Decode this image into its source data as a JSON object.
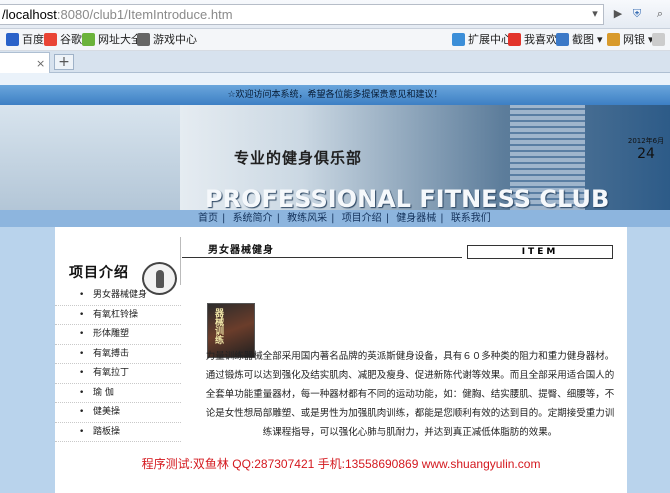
{
  "browser": {
    "url_main": "/localhost",
    "url_rest": ":8080/club1/ItemIntroduce.htm",
    "bookmarks": [
      {
        "label": "百度",
        "color": "#2a62c9"
      },
      {
        "label": "谷歌",
        "color": "#e94435"
      },
      {
        "label": "网址大全",
        "color": "#6bb33b"
      },
      {
        "label": "游戏中心",
        "color": "#666666"
      },
      {
        "label": "扩展中心",
        "color": "#3b8ed8"
      },
      {
        "label": "我喜欢",
        "color": "#e2342b"
      },
      {
        "label": "截图",
        "color": "#3c79c7"
      },
      {
        "label": "网银",
        "color": "#d89a2c"
      }
    ],
    "tab_close": "×",
    "new_tab": "+"
  },
  "site": {
    "welcome": "☆欢迎访问本系统，希望各位能多提保贵意见和建议！",
    "slogan": "专业的健身俱乐部",
    "title": "PROFESSIONAL FITNESS CLUB",
    "date_month": "2012年6月",
    "date_day": "24",
    "nav": [
      "首页",
      "系统简介",
      "教练风采",
      "项目介绍",
      "健身器械",
      "联系我们"
    ]
  },
  "sidebar": {
    "title": "项目介绍",
    "items": [
      "男女器械健身",
      "有氧杠铃操",
      "形体雕塑",
      "有氧搏击",
      "有氧拉丁",
      "瑜 伽",
      "健美操",
      "踏板操"
    ]
  },
  "main": {
    "section_title": "男女器械健身",
    "item_label": "ITEM",
    "photo_caption": "器械训练",
    "body": "力量训练器械全部采用国内著名品牌的英派斯健身设备，具有６０多种类的阻力和重力健身器材。通过锻炼可以达到强化及结实肌肉、减肥及瘦身、促进新陈代谢等效果。而且全部采用适合国人的全套单功能重量器材，每一种器材都有不同的运动功能，如：健胸、结实腰肌、提臀、细腰等，不论是女性想局部雕塑、或是男性为加强肌肉训练，都能是您顺利有效的达到目的。定期接受重力训练课程指导，可以强化心肺与肌耐力，并达到真正减低体脂肪的效果。",
    "credit": "程序测试:双鱼林 QQ:287307421 手机:13558690869 www.shuangyulin.com"
  }
}
